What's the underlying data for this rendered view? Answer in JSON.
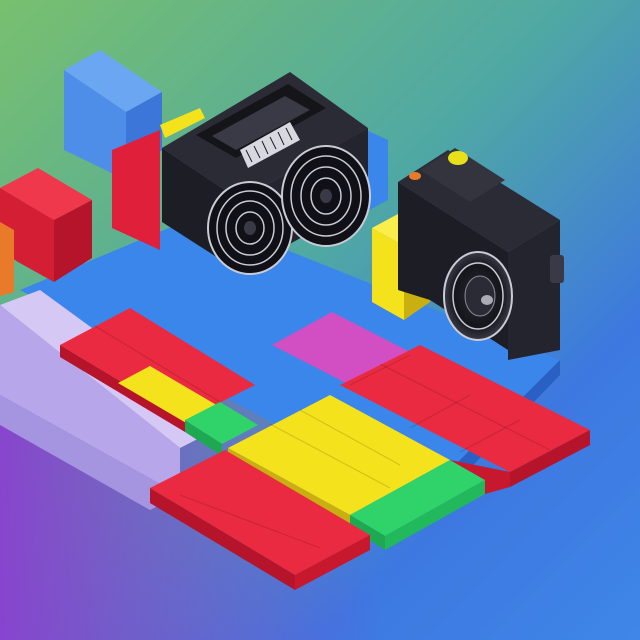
{
  "scene": {
    "description_tags": [
      "isometric",
      "toy-blocks",
      "cameras"
    ],
    "palette": {
      "bg_green": "#7fbf6a",
      "bg_teal": "#4fa9a0",
      "bg_blue": "#3c7fe0",
      "bg_purple": "#8a3fd0",
      "red": "#e8243c",
      "red_dark": "#b5142a",
      "yellow": "#f4e21c",
      "yellow_dark": "#c9b010",
      "green": "#2fd36a",
      "blue": "#3b86ea",
      "blue_dark": "#2a5fc4",
      "lavender": "#c6b6ee",
      "magenta": "#d14fc2",
      "camera_black": "#1d1d25",
      "camera_gray": "#3a3a46",
      "lens_silver": "#c9ccd6",
      "button_yellow": "#e8e01a",
      "orange": "#e97a2a"
    },
    "objects": [
      "large-boombox-camera",
      "small-camera",
      "red-block",
      "blue-block",
      "yellow-block",
      "colored-brick-floor"
    ]
  }
}
